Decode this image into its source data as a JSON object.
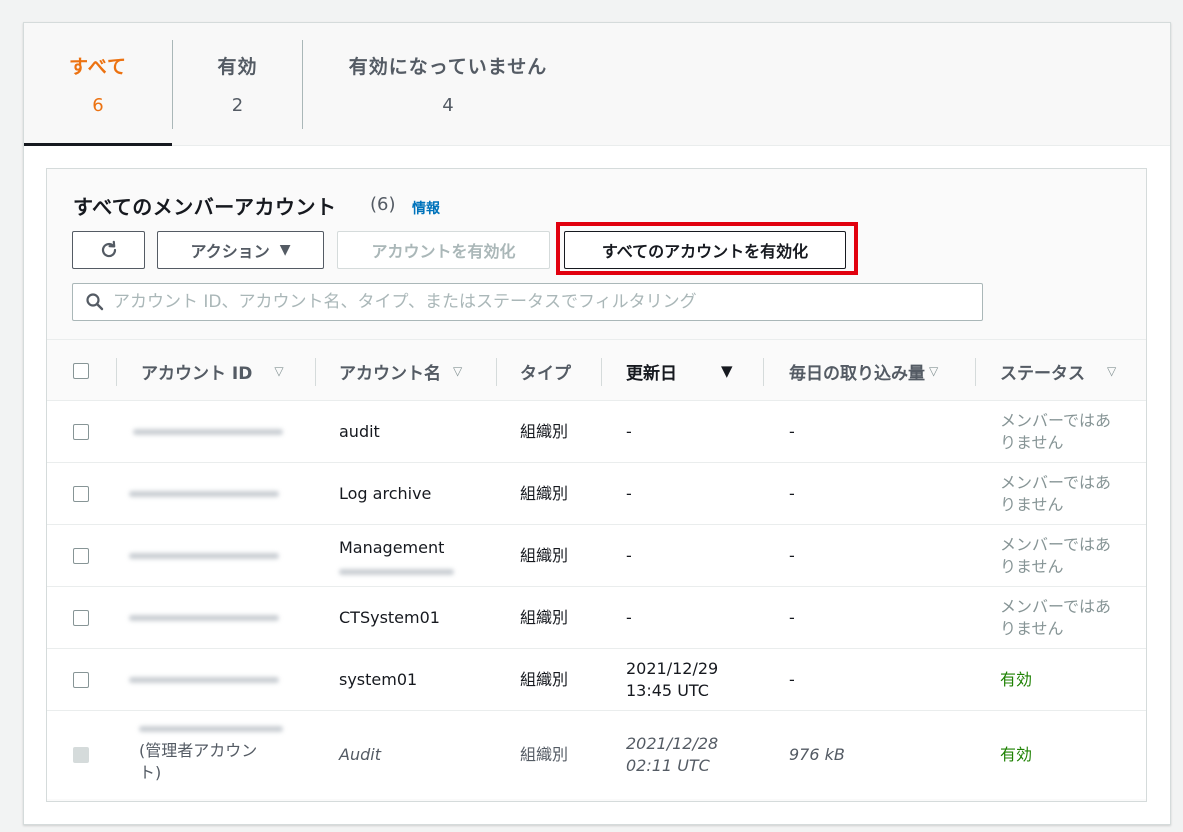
{
  "tabs": [
    {
      "label": "すべて",
      "count": "6"
    },
    {
      "label": "有効",
      "count": "2"
    },
    {
      "label": "有効になっていません",
      "count": "4"
    }
  ],
  "panel": {
    "title": "すべてのメンバーアカウント",
    "count": "(6)",
    "info_link": "情報"
  },
  "toolbar": {
    "action_label": "アクション",
    "enable_label": "アカウントを有効化",
    "enable_all_label": "すべてのアカウントを有効化"
  },
  "search": {
    "placeholder": "アカウント ID、アカウント名、タイプ、またはステータスでフィルタリング"
  },
  "table": {
    "headers": {
      "account_id": "アカウント ID",
      "account_name": "アカウント名",
      "type": "タイプ",
      "updated": "更新日",
      "daily_ingest": "毎日の取り込み量",
      "status": "ステータス"
    },
    "rows": [
      {
        "name": "audit",
        "type": "組織別",
        "updated": "-",
        "ingest": "-",
        "status_1": "メンバーではあ",
        "status_2": "りません"
      },
      {
        "name": "Log archive",
        "type": "組織別",
        "updated": "-",
        "ingest": "-",
        "status_1": "メンバーではあ",
        "status_2": "りません"
      },
      {
        "name": "Management",
        "type": "組織別",
        "updated": "-",
        "ingest": "-",
        "status_1": "メンバーではあ",
        "status_2": "りません"
      },
      {
        "name": "CTSystem01",
        "type": "組織別",
        "updated": "-",
        "ingest": "-",
        "status_1": "メンバーではあ",
        "status_2": "りません"
      },
      {
        "name": "system01",
        "type": "組織別",
        "updated_1": "2021/12/29",
        "updated_2": "13:45 UTC",
        "ingest": "-",
        "status": "有効"
      },
      {
        "id_note_1": "(管理者アカウン",
        "id_note_2": "ト)",
        "name": "Audit",
        "type": "組織別",
        "updated_1": "2021/12/28",
        "updated_2": "02:11 UTC",
        "ingest": "976 kB",
        "status": "有効"
      }
    ]
  },
  "colors": {
    "active_tab": "#ec7211",
    "link": "#0073bb",
    "enabled_status": "#1d8102",
    "highlight_box": "#e1000e"
  },
  "icons": [
    "refresh-icon",
    "caret-down-icon",
    "search-icon",
    "sort-icon",
    "sort-desc-icon"
  ]
}
